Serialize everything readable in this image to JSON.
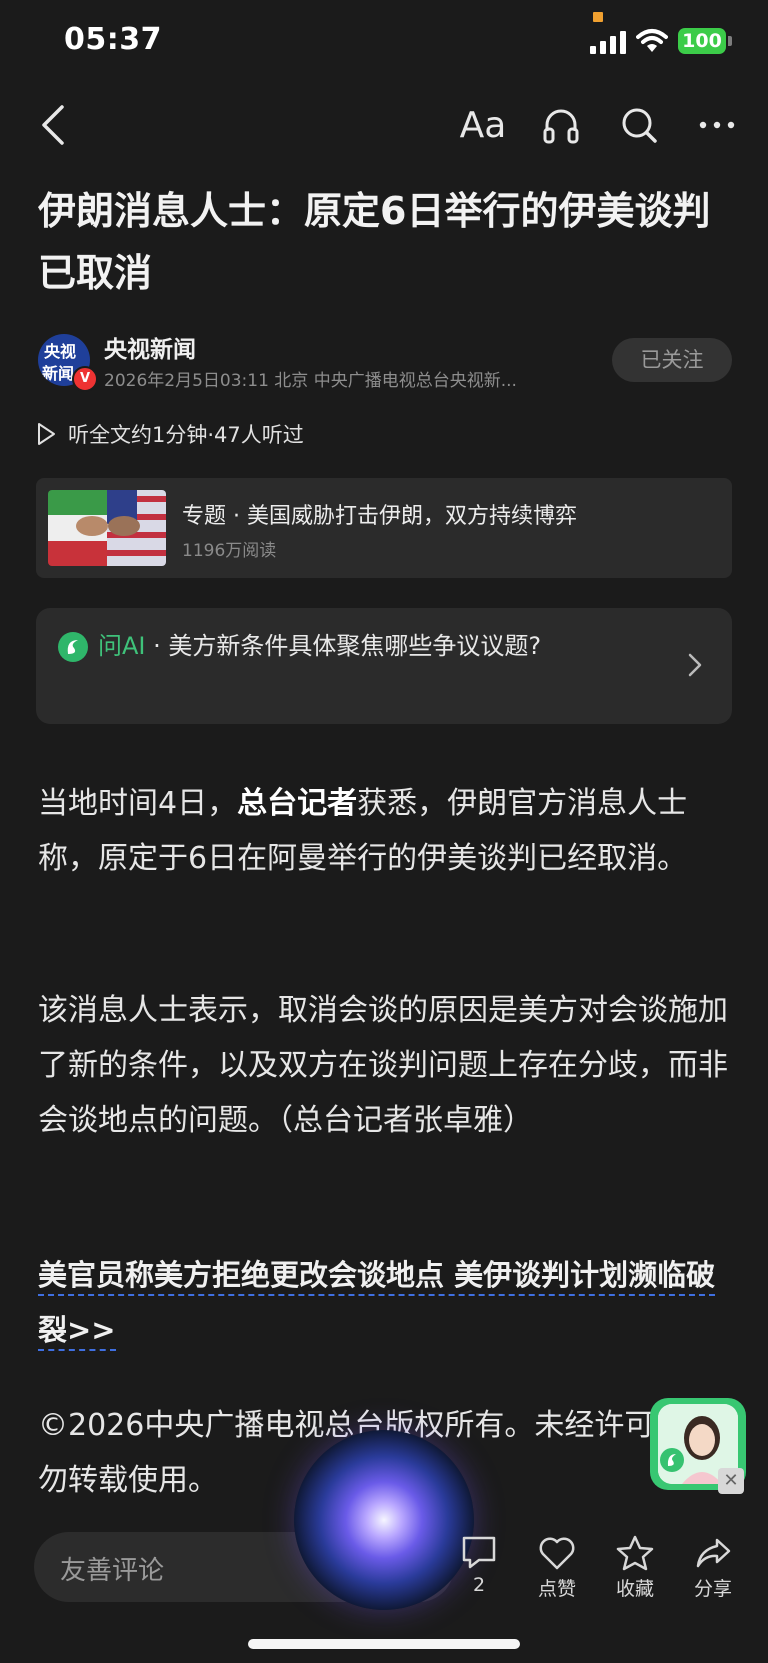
{
  "status_bar": {
    "time": "05:37",
    "battery": "100"
  },
  "nav": {
    "font_size_label": "Aa"
  },
  "article": {
    "title": "伊朗消息人士：原定6日举行的伊美谈判已取消",
    "author": "央视新闻",
    "avatar_text_top": "央视",
    "avatar_text_bottom": "新闻",
    "avatar_badge": "V",
    "meta": "2026年2月5日03:11 北京 中央广播电视总台央视新...",
    "follow_label": "已关注",
    "listen": "听全文约1分钟·47人听过",
    "paragraph1_a": "当地时间4日，",
    "paragraph1_bold": "总台记者",
    "paragraph1_b": "获悉，伊朗官方消息人士称，原定于6日在阿曼举行的伊美谈判已经取消。",
    "paragraph2": "该消息人士表示，取消会谈的原因是美方对会谈施加了新的条件，以及双方在谈判问题上存在分歧，而非会谈地点的问题。（总台记者张卓雅）",
    "related_link": "美官员称美方拒绝更改会谈地点 美伊谈判计划濒临破裂>>",
    "copyright": "©2026中央广播电视总台版权所有。未经许可，请勿转载使用。"
  },
  "topic": {
    "title": "专题 · 美国威胁打击伊朗，双方持续博弈",
    "reads": "1196万阅读"
  },
  "ask_ai": {
    "brand": "问AI",
    "question": " · 美方新条件具体聚焦哪些争议议题?"
  },
  "bottom_bar": {
    "comment_placeholder": "友善评论",
    "comment_count": "2",
    "like_label": "点赞",
    "collect_label": "收藏",
    "share_label": "分享"
  },
  "colors": {
    "background": "#1b1b1b",
    "accent_green": "#2fb66a",
    "link_underline": "#3f6fe0",
    "battery": "#3ccc49"
  }
}
